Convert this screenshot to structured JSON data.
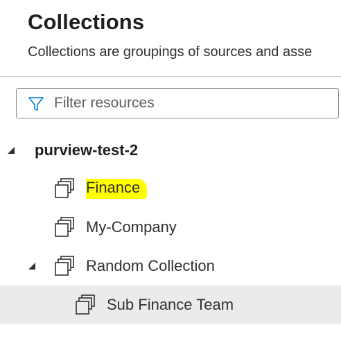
{
  "header": {
    "title": "Collections",
    "subtitle": "Collections are groupings of sources and asse"
  },
  "filter": {
    "placeholder": "Filter resources",
    "value": ""
  },
  "tree": {
    "root": {
      "label": "purview-test-2",
      "expanded": true
    },
    "items": [
      {
        "label": "Finance",
        "highlighted": true,
        "icon": "collection-icon"
      },
      {
        "label": "My-Company",
        "icon": "collection-icon"
      },
      {
        "label": "Random Collection",
        "expanded": true,
        "icon": "collection-icon"
      },
      {
        "label": "Sub Finance Team",
        "selected": true,
        "icon": "collection-icon"
      }
    ]
  },
  "colors": {
    "highlight": "#ffff00",
    "selected_row": "#edebe9",
    "filter_icon": "#0078d4",
    "divider": "#c8c6c4"
  }
}
